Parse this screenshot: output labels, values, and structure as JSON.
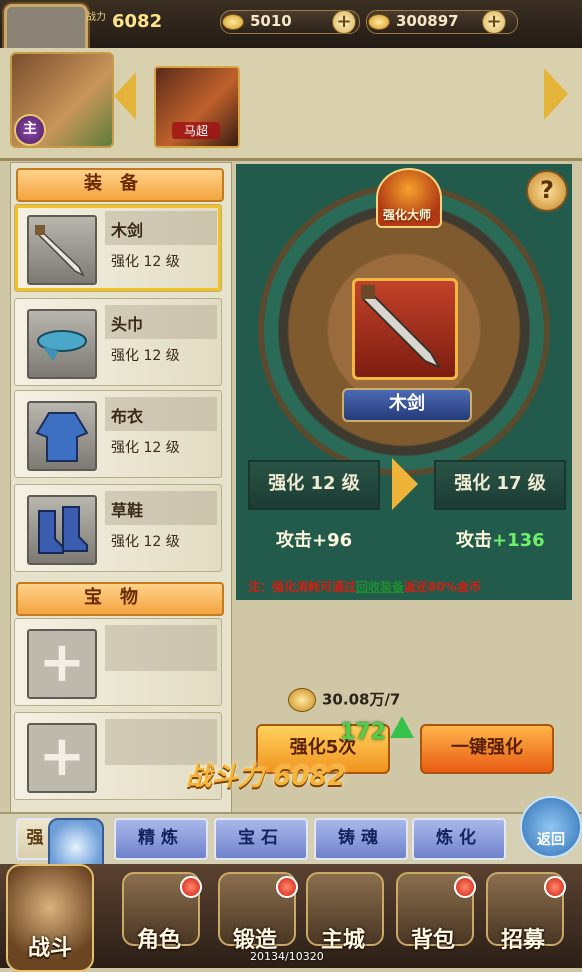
{
  "topbar": {
    "power_label": "战力",
    "power_value": "6082",
    "gold_value": "5010",
    "silver_value": "300897",
    "plus_label": "+"
  },
  "heroes": {
    "lord_badge": "主",
    "selected_hero_name": "马超"
  },
  "equipment": {
    "section_title": "装备",
    "items": [
      {
        "name": "木剑",
        "level": "强化 12 级"
      },
      {
        "name": "头巾",
        "level": "强化 12 级"
      },
      {
        "name": "布衣",
        "level": "强化 12 级"
      },
      {
        "name": "草鞋",
        "level": "强化 12 级"
      }
    ]
  },
  "treasure": {
    "section_title": "宝物",
    "plus": "+"
  },
  "enhance": {
    "master_label": "强化大师",
    "help_label": "?",
    "weapon_name": "木剑",
    "current_level": "强化 12 级",
    "next_level": "强化 17 级",
    "current_attack_label": "攻击",
    "current_attack_value": "+96",
    "next_attack_label": "攻击",
    "next_attack_value": "+136",
    "note_prefix": "注：强化消耗可通过",
    "note_link": "回收装备",
    "note_suffix": "返还80%金币",
    "cost": "30.08万/7",
    "btn_enhance5": "强化5次",
    "btn_onekey": "一键强化",
    "float_number": "172",
    "battle_power": "战斗力 6082"
  },
  "tabs": {
    "first": "强",
    "items": [
      "精炼",
      "宝石",
      "铸魂",
      "炼化"
    ],
    "return_label": "返回"
  },
  "bottom_nav": {
    "battle": "战斗",
    "items": [
      "角色",
      "锻造",
      "主城",
      "背包",
      "招募"
    ],
    "exp": "20134/10320"
  },
  "colors": {
    "panel_green": "#225b4c",
    "header_orange": "#f3a43f",
    "tab_blue": "#6f83cc",
    "note_red": "#d21f12",
    "attack_green": "#6ef06a"
  }
}
